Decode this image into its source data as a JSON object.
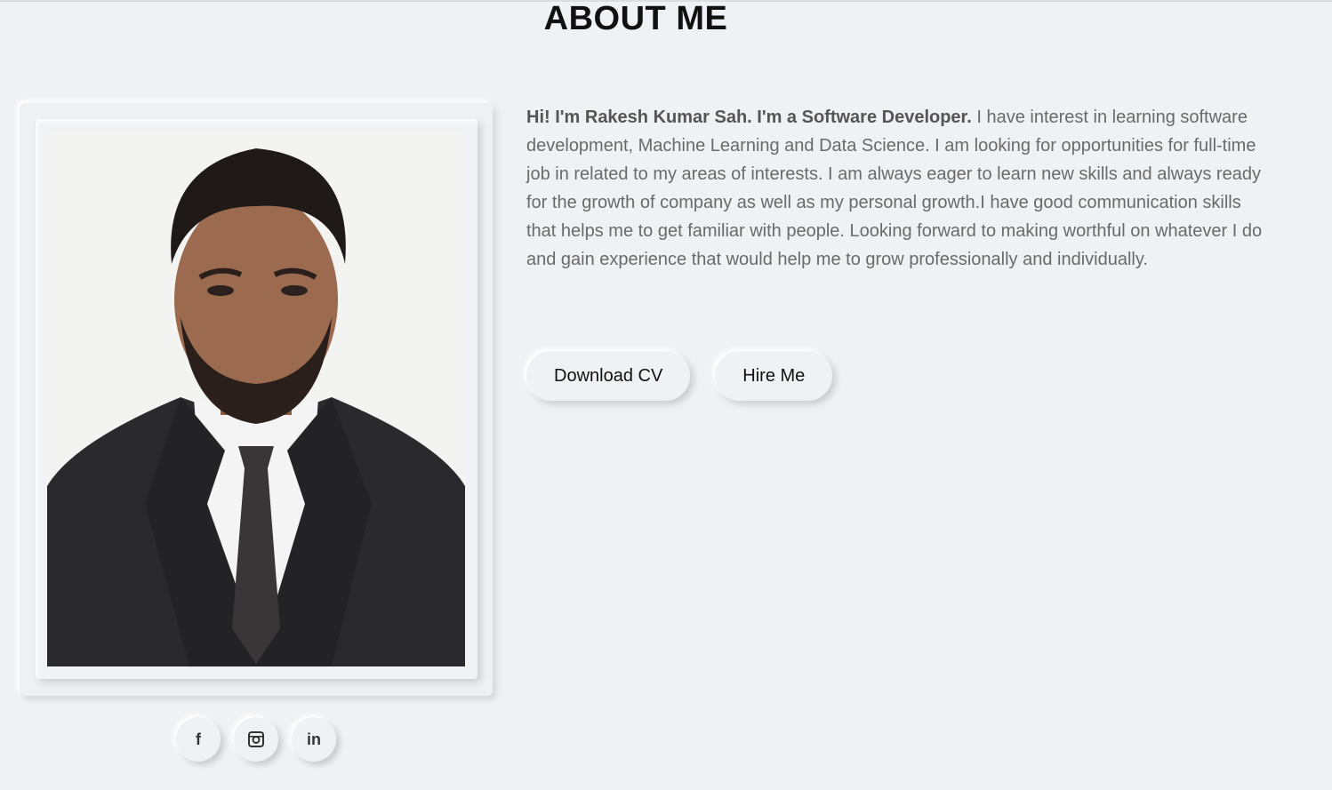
{
  "section": {
    "title": "ABOUT ME"
  },
  "profile": {
    "photo_icon": "portrait-photo"
  },
  "bio": {
    "intro": "Hi! I'm Rakesh Kumar Sah. I'm a Software Developer.",
    "body": " I have interest in learning software development, Machine Learning and Data Science. I am looking for opportunities for full-time job in related to my areas of interests. I am always eager to learn new skills and always ready for the growth of company as well as my personal growth.I have good communication skills that helps me to get familiar with people. Looking forward to making worthful on whatever I do and gain experience that would help me to grow professionally and individually."
  },
  "actions": {
    "download_cv": "Download CV",
    "hire_me": "Hire Me"
  },
  "social": {
    "facebook_glyph": "f",
    "linkedin_glyph": "in",
    "icons": [
      "facebook-icon",
      "instagram-icon",
      "linkedin-icon"
    ]
  },
  "colors": {
    "background": "#f0f1f4",
    "title": "#111111",
    "text": "#6a6a6a"
  }
}
